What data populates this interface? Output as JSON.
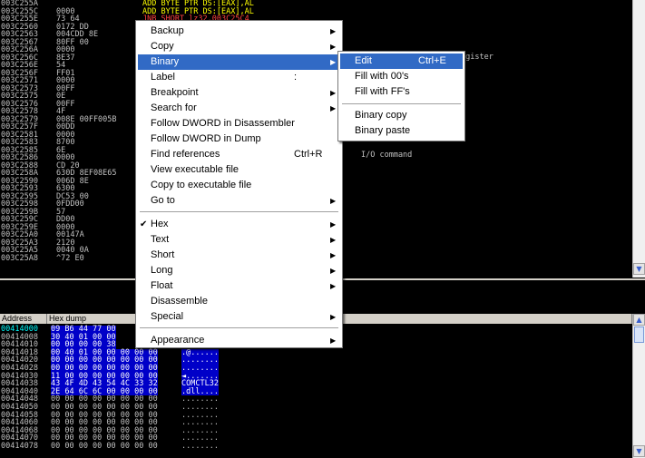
{
  "cpu": {
    "rows": [
      {
        "addr": "003C255A",
        "hex": "",
        "ins": "ADD BYTE PTR DS:[EAX],AL",
        "color": "#ffff00"
      },
      {
        "addr": "003C255C",
        "hex": "0000",
        "ins": "ADD BYTE PTR DS:[EAX],AL",
        "color": "#ffff00"
      },
      {
        "addr": "003C255E",
        "hex": "73 64",
        "ins": "JNB SHORT lz32.003C25C4",
        "color": "#ff4040"
      },
      {
        "addr": "003C2560",
        "hex": "0172 DD",
        "ins": "",
        "color": "#c0c0c0"
      },
      {
        "addr": "003C2563",
        "hex": "004CDD 8E",
        "ins": "",
        "color": "#c0c0c0"
      },
      {
        "addr": "003C2567",
        "hex": "80FF 00",
        "ins": "",
        "color": "#c0c0c0"
      },
      {
        "addr": "003C256A",
        "hex": "0000",
        "ins": "",
        "color": "#c0c0c0"
      },
      {
        "addr": "003C256C",
        "hex": "8E37",
        "ins": "",
        "color": "#c0c0c0"
      },
      {
        "addr": "003C256E",
        "hex": "54",
        "ins": "",
        "color": "#c0c0c0"
      },
      {
        "addr": "003C256F",
        "hex": "FF01",
        "ins": "",
        "color": "#c0c0c0"
      },
      {
        "addr": "003C2571",
        "hex": "0000",
        "ins": "",
        "color": "#c0c0c0"
      },
      {
        "addr": "003C2573",
        "hex": "00FF",
        "ins": "",
        "color": "#c0c0c0"
      },
      {
        "addr": "003C2575",
        "hex": "0E",
        "ins": "",
        "color": "#c0c0c0"
      },
      {
        "addr": "003C2576",
        "hex": "00FF",
        "ins": "",
        "color": "#c0c0c0"
      },
      {
        "addr": "003C2578",
        "hex": "4F",
        "ins": "",
        "color": "#c0c0c0"
      },
      {
        "addr": "003C2579",
        "hex": "008E 00FF005B",
        "ins": "",
        "color": "#c0c0c0"
      },
      {
        "addr": "003C257F",
        "hex": "00DD",
        "ins": "",
        "color": "#c0c0c0"
      },
      {
        "addr": "003C2581",
        "hex": "0000",
        "ins": "",
        "color": "#c0c0c0"
      },
      {
        "addr": "003C2583",
        "hex": "8700",
        "ins": "",
        "color": "#c0c0c0"
      },
      {
        "addr": "003C2585",
        "hex": "6E",
        "ins": "",
        "color": "#c0c0c0"
      },
      {
        "addr": "003C2586",
        "hex": "0000",
        "ins": "",
        "color": "#c0c0c0"
      },
      {
        "addr": "003C2588",
        "hex": "CD 20",
        "ins": "",
        "color": "#c0c0c0"
      },
      {
        "addr": "003C258A",
        "hex": "630D 8EF08E65",
        "ins": "",
        "color": "#c0c0c0"
      },
      {
        "addr": "003C2590",
        "hex": "006D 8E",
        "ins": "",
        "color": "#c0c0c0"
      },
      {
        "addr": "003C2593",
        "hex": "6300",
        "ins": "",
        "color": "#c0c0c0"
      },
      {
        "addr": "003C2595",
        "hex": "DC53 00",
        "ins": "",
        "color": "#c0c0c0"
      },
      {
        "addr": "003C2598",
        "hex": "0FDD00",
        "ins": "",
        "color": "#c0c0c0"
      },
      {
        "addr": "003C259B",
        "hex": "57",
        "ins": "",
        "color": "#c0c0c0"
      },
      {
        "addr": "003C259C",
        "hex": "DD00",
        "ins": "",
        "color": "#c0c0c0"
      },
      {
        "addr": "003C259E",
        "hex": "0000",
        "ins": "",
        "color": "#c0c0c0"
      },
      {
        "addr": "003C25A0",
        "hex": "00147A",
        "ins": "",
        "color": "#c0c0c0"
      },
      {
        "addr": "003C25A3",
        "hex": "2120",
        "ins": "",
        "color": "#c0c0c0"
      },
      {
        "addr": "003C25A5",
        "hex": "0040 0A",
        "ins": "",
        "color": "#c0c0c0"
      },
      {
        "addr": "003C25A8",
        "hex": "^72 E0",
        "ins": "",
        "color": "#c0c0c0"
      }
    ],
    "comments": [
      "egister",
      "I/O command"
    ]
  },
  "dump": {
    "headers": [
      "Address",
      "Hex dump"
    ],
    "rows": [
      {
        "addr": "00414000",
        "bytes": "09 B6 44 77 00",
        "ascii": ""
      },
      {
        "addr": "00414008",
        "bytes": "30 40 01 00 00",
        "ascii": ""
      },
      {
        "addr": "00414010",
        "bytes": "00 00 00 00 38",
        "ascii": ""
      },
      {
        "addr": "00414018",
        "bytes": "00 40 01 00 00 00 00 00",
        "ascii": ".@......"
      },
      {
        "addr": "00414020",
        "bytes": "00 00 00 00 00 00 00 00",
        "ascii": "........"
      },
      {
        "addr": "00414028",
        "bytes": "00 00 00 00 00 00 00 00",
        "ascii": "........"
      },
      {
        "addr": "00414030",
        "bytes": "11 00 00 00 00 00 00 00",
        "ascii": "◄......."
      },
      {
        "addr": "00414038",
        "bytes": "43 4F 4D 43 54 4C 33 32",
        "ascii": "COMCTL32"
      },
      {
        "addr": "00414040",
        "bytes": "2E 64 6C 6C 00 00 00 00",
        "ascii": ".dll...."
      },
      {
        "addr": "00414048",
        "bytes": "00 00 00 00 00 00 00 00",
        "ascii": "........"
      },
      {
        "addr": "00414050",
        "bytes": "00 00 00 00 00 00 00 00",
        "ascii": "........"
      },
      {
        "addr": "00414058",
        "bytes": "00 00 00 00 00 00 00 00",
        "ascii": "........"
      },
      {
        "addr": "00414060",
        "bytes": "00 00 00 00 00 00 00 00",
        "ascii": "........"
      },
      {
        "addr": "00414068",
        "bytes": "00 00 00 00 00 00 00 00",
        "ascii": "........"
      },
      {
        "addr": "00414070",
        "bytes": "00 00 00 00 00 00 00 00",
        "ascii": "........"
      },
      {
        "addr": "00414078",
        "bytes": "00 00 00 00 00 00 00 00",
        "ascii": "........"
      }
    ]
  },
  "menu": {
    "items": [
      {
        "label": "Backup",
        "shortcut": "",
        "submenu": true,
        "checked": false
      },
      {
        "label": "Copy",
        "shortcut": "",
        "submenu": true,
        "checked": false
      },
      {
        "label": "Binary",
        "shortcut": "",
        "submenu": true,
        "checked": false,
        "highlighted": true
      },
      {
        "label": "Label",
        "shortcut": ":",
        "submenu": false,
        "checked": false
      },
      {
        "label": "Breakpoint",
        "shortcut": "",
        "submenu": true,
        "checked": false
      },
      {
        "label": "Search for",
        "shortcut": "",
        "submenu": true,
        "checked": false
      },
      {
        "label": "Follow DWORD in Disassembler",
        "shortcut": "",
        "submenu": false,
        "checked": false
      },
      {
        "label": "Follow DWORD in Dump",
        "shortcut": "",
        "submenu": false,
        "checked": false
      },
      {
        "label": "Find references",
        "shortcut": "Ctrl+R",
        "submenu": false,
        "checked": false
      },
      {
        "label": "View executable file",
        "shortcut": "",
        "submenu": false,
        "checked": false
      },
      {
        "label": "Copy to executable file",
        "shortcut": "",
        "submenu": false,
        "checked": false
      },
      {
        "label": "Go to",
        "shortcut": "",
        "submenu": true,
        "checked": false
      },
      {
        "label": "Hex",
        "shortcut": "",
        "submenu": true,
        "checked": true
      },
      {
        "label": "Text",
        "shortcut": "",
        "submenu": true,
        "checked": false
      },
      {
        "label": "Short",
        "shortcut": "",
        "submenu": true,
        "checked": false
      },
      {
        "label": "Long",
        "shortcut": "",
        "submenu": true,
        "checked": false
      },
      {
        "label": "Float",
        "shortcut": "",
        "submenu": true,
        "checked": false
      },
      {
        "label": "Disassemble",
        "shortcut": "",
        "submenu": false,
        "checked": false
      },
      {
        "label": "Special",
        "shortcut": "",
        "submenu": true,
        "checked": false
      },
      {
        "label": "Appearance",
        "shortcut": "",
        "submenu": true,
        "checked": false
      }
    ]
  },
  "submenu": {
    "items": [
      {
        "label": "Edit",
        "shortcut": "Ctrl+E",
        "highlighted": true
      },
      {
        "label": "Fill with 00's",
        "shortcut": ""
      },
      {
        "label": "Fill with FF's",
        "shortcut": ""
      },
      {
        "label": "Binary copy",
        "shortcut": ""
      },
      {
        "label": "Binary paste",
        "shortcut": ""
      }
    ]
  },
  "icons": {
    "submenu_arrow": "▶",
    "check": "✔",
    "scroll_up": "▲",
    "scroll_down": "▼"
  },
  "colors": {
    "highlight": "#316ac5",
    "selection": "#0000c8",
    "jump": "#ff4040",
    "instr": "#ffff00",
    "current_address": "#00ffff"
  }
}
